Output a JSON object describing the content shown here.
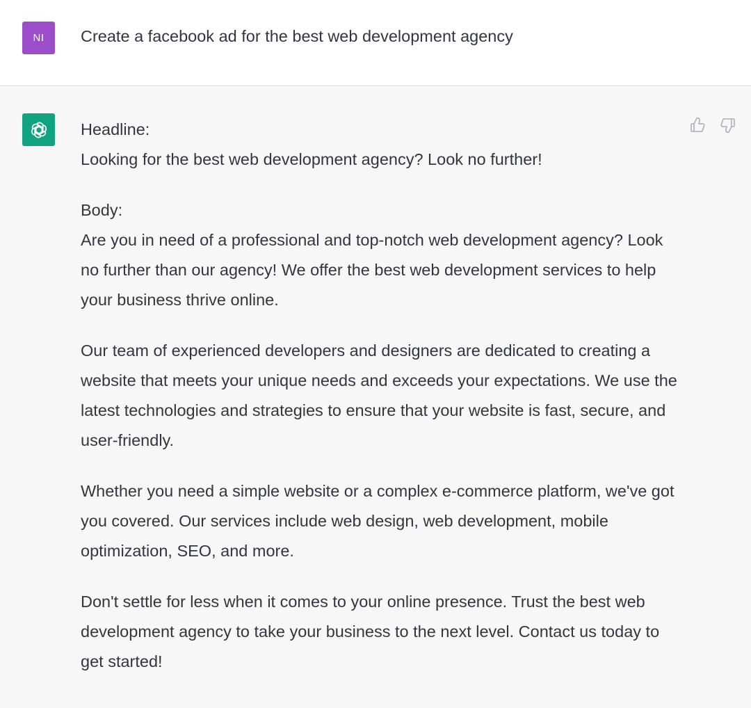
{
  "user": {
    "avatar_initials": "NI",
    "message": "Create a facebook ad for the best web development agency"
  },
  "assistant": {
    "headline_label": "Headline:",
    "headline_text": "Looking for the best web development agency? Look no further!",
    "body_label": "Body:",
    "paragraphs": [
      "Are you in need of a professional and top-notch web development agency? Look no further than our agency! We offer the best web development services to help your business thrive online.",
      "Our team of experienced developers and designers are dedicated to creating a website that meets your unique needs and exceeds your expectations. We use the latest technologies and strategies to ensure that your website is fast, secure, and user-friendly.",
      "Whether you need a simple website or a complex e-commerce platform, we've got you covered. Our services include web design, web development, mobile optimization, SEO, and more.",
      "Don't settle for less when it comes to your online presence. Trust the best web development agency to take your business to the next level. Contact us today to get started!"
    ]
  },
  "icons": {
    "bot_avatar": "openai-logo-icon",
    "thumbs_up": "thumbs-up-icon",
    "thumbs_down": "thumbs-down-icon"
  },
  "colors": {
    "user_avatar": "#9b4dca",
    "bot_avatar": "#10a37f",
    "assistant_bg": "#f7f7f8",
    "text": "#343541"
  }
}
